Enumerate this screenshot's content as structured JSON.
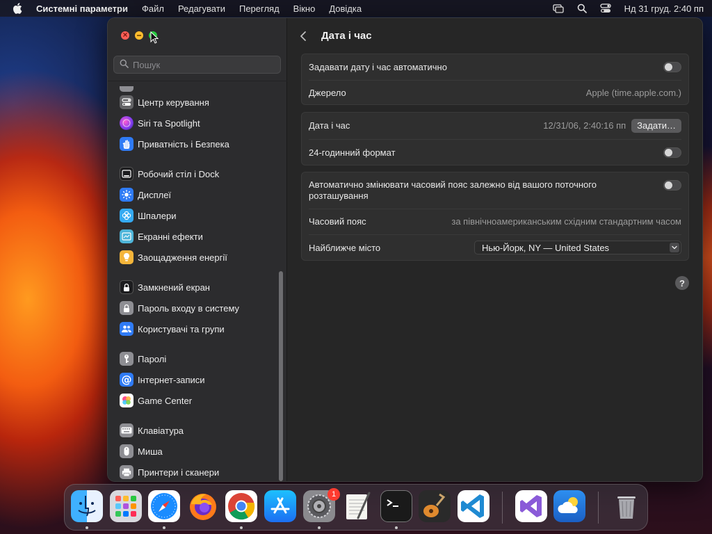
{
  "menubar": {
    "app_name": "Системні параметри",
    "items": [
      "Файл",
      "Редагувати",
      "Перегляд",
      "Вікно",
      "Довідка"
    ],
    "clock": "Нд 31 груд.  2:40 пп"
  },
  "sidebar": {
    "search_placeholder": "Пошук",
    "items": [
      {
        "label": "Центр керування",
        "icon": "control-center-icon",
        "color": "#636366"
      },
      {
        "label": "Siri та Spotlight",
        "icon": "siri-icon",
        "color": "#b43cd8"
      },
      {
        "label": "Приватність і Безпека",
        "icon": "hand-icon",
        "color": "#2f7bf6"
      },
      {
        "label": "Робочий стіл і Dock",
        "icon": "desktop-dock-icon",
        "color": "#1c1c1e"
      },
      {
        "label": "Дисплеї",
        "icon": "display-icon",
        "color": "#2f7bf6"
      },
      {
        "label": "Шпалери",
        "icon": "wallpaper-icon",
        "color": "#35aaf2"
      },
      {
        "label": "Екранні ефекти",
        "icon": "screensaver-icon",
        "color": "#4fb5d9"
      },
      {
        "label": "Заощадження енергії",
        "icon": "lightbulb-icon",
        "color": "#f5b53a"
      },
      {
        "label": "Замкнений екран",
        "icon": "lock-screen-icon",
        "color": "#1c1c1e"
      },
      {
        "label": "Пароль входу в систему",
        "icon": "lock-icon",
        "color": "#8e8e93"
      },
      {
        "label": "Користувачі та групи",
        "icon": "users-icon",
        "color": "#2f7bf6"
      },
      {
        "label": "Паролі",
        "icon": "key-icon",
        "color": "#8e8e93"
      },
      {
        "label": "Інтернет-записи",
        "icon": "at-icon",
        "color": "#2f7bf6"
      },
      {
        "label": "Game Center",
        "icon": "game-center-icon",
        "color": "#ffffff"
      },
      {
        "label": "Клавіатура",
        "icon": "keyboard-icon",
        "color": "#8e8e93"
      },
      {
        "label": "Миша",
        "icon": "mouse-icon",
        "color": "#8e8e93"
      },
      {
        "label": "Принтери і сканери",
        "icon": "printer-icon",
        "color": "#8e8e93"
      }
    ]
  },
  "content": {
    "title": "Дата і час",
    "auto_datetime_label": "Задавати дату і час автоматично",
    "auto_datetime_on": false,
    "source_label": "Джерело",
    "source_value": "Apple (time.apple.com.)",
    "datetime_label": "Дата і час",
    "datetime_value": "12/31/06, 2:40:16 пп",
    "set_button": "Задати…",
    "format24_label": "24-годинний формат",
    "format24_on": false,
    "auto_tz_label": "Автоматично змінювати часовий пояс залежно від вашого поточного розташування",
    "auto_tz_on": false,
    "timezone_label": "Часовий пояс",
    "timezone_value": "за північноамериканським східним стандартним часом",
    "city_label": "Найближче місто",
    "city_value": "Нью-Йорк, NY — United States",
    "help": "?"
  },
  "dock": {
    "apps": [
      {
        "name": "Finder",
        "icon": "finder-icon"
      },
      {
        "name": "Launchpad",
        "icon": "launchpad-icon"
      },
      {
        "name": "Safari",
        "icon": "safari-icon"
      },
      {
        "name": "Firefox",
        "icon": "firefox-icon"
      },
      {
        "name": "Chrome",
        "icon": "chrome-icon"
      },
      {
        "name": "App Store",
        "icon": "app-store-icon"
      },
      {
        "name": "System Settings",
        "icon": "system-settings-icon",
        "badge": "1"
      },
      {
        "name": "TextEdit",
        "icon": "textedit-icon"
      },
      {
        "name": "Terminal",
        "icon": "terminal-icon"
      },
      {
        "name": "GarageBand",
        "icon": "garageband-icon"
      },
      {
        "name": "VS Code",
        "icon": "vscode-icon"
      },
      {
        "name": "Visual Studio",
        "icon": "visual-studio-icon"
      },
      {
        "name": "Weather",
        "icon": "weather-icon"
      },
      {
        "name": "Trash",
        "icon": "trash-icon"
      }
    ]
  }
}
